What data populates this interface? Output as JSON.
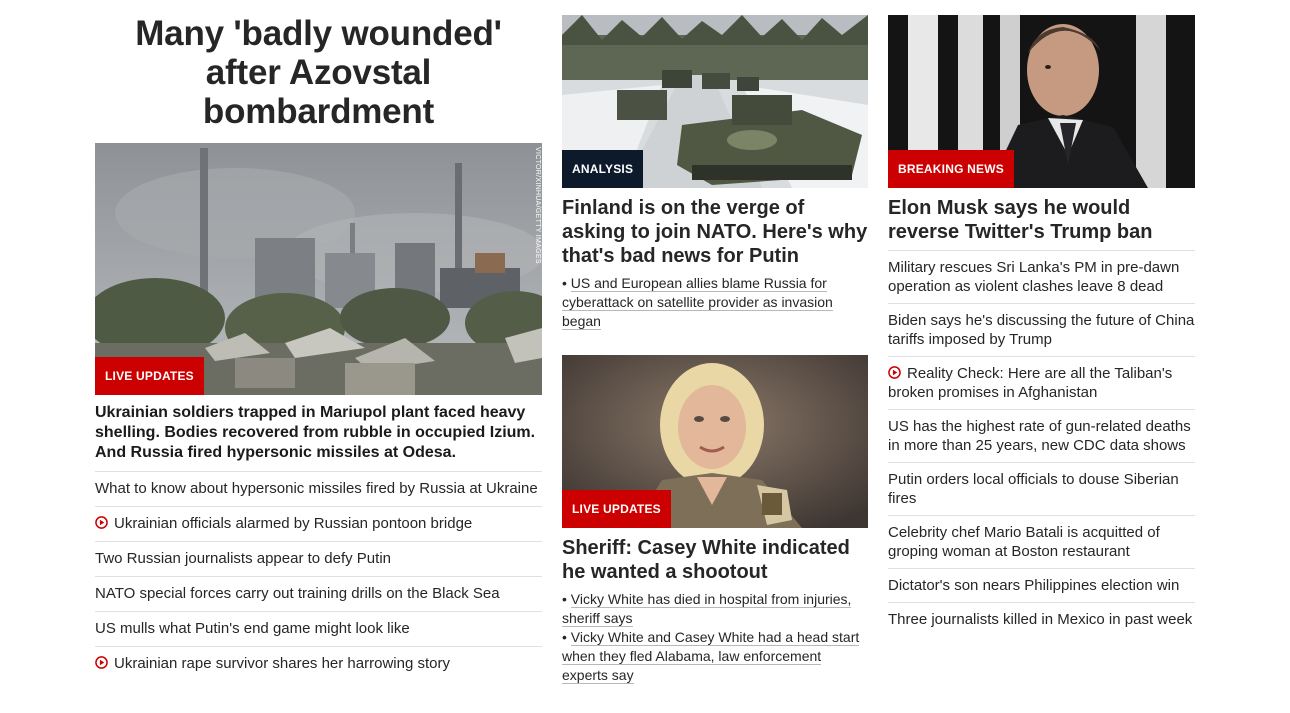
{
  "lead": {
    "headline": "Many 'badly wounded' after Azovstal bombardment",
    "badge": "LIVE UPDATES",
    "photo_credit": "VICTOR/XINHUA/GETTY IMAGES",
    "summary": "Ukrainian soldiers trapped in Mariupol plant faced heavy shelling. Bodies recovered from rubble in occupied Izium. And Russia fired hypersonic missiles at Odesa.",
    "related": [
      {
        "text": "What to know about hypersonic missiles fired by Russia at Ukraine",
        "video": false
      },
      {
        "text": "Ukrainian officials alarmed by Russian pontoon bridge",
        "video": true
      },
      {
        "text": "Two Russian journalists appear to defy Putin",
        "video": false
      },
      {
        "text": "NATO special forces carry out training drills on the Black Sea",
        "video": false
      },
      {
        "text": "US mulls what Putin's end game might look like",
        "video": false
      },
      {
        "text": "Ukrainian rape survivor shares her harrowing story",
        "video": true
      }
    ]
  },
  "finland": {
    "badge": "ANALYSIS",
    "headline": "Finland is on the verge of asking to join NATO. Here's why that's bad news for Putin",
    "bullets": [
      "US and European allies blame Russia for cyberattack on satellite provider as invasion began"
    ]
  },
  "sheriff": {
    "badge": "LIVE UPDATES",
    "headline": "Sheriff: Casey White indicated he wanted a shootout",
    "bullets": [
      "Vicky White has died in hospital from injuries, sheriff says",
      "Vicky White and Casey White had a head start when they fled Alabama, law enforcement experts say"
    ]
  },
  "musk": {
    "badge": "BREAKING NEWS",
    "headline": "Elon Musk says he would reverse Twitter's Trump ban",
    "stories": [
      {
        "text": "Military rescues Sri Lanka's PM in pre-dawn operation as violent clashes leave 8 dead",
        "video": false
      },
      {
        "text": "Biden says he's discussing the future of China tariffs imposed by Trump",
        "video": false
      },
      {
        "text": "Reality Check: Here are all the Taliban's broken promises in Afghanistan",
        "video": true
      },
      {
        "text": "US has the highest rate of gun-related deaths in more than 25 years, new CDC data shows",
        "video": false
      },
      {
        "text": "Putin orders local officials to douse Siberian fires",
        "video": false
      },
      {
        "text": "Celebrity chef Mario Batali is acquitted of groping woman at Boston restaurant",
        "video": false
      },
      {
        "text": "Dictator's son nears Philippines election win",
        "video": false
      },
      {
        "text": "Three journalists killed in Mexico in past week",
        "video": false
      }
    ]
  },
  "colors": {
    "brand_red": "#cc0000",
    "analysis_navy": "#0c1a2c",
    "text": "#262626"
  },
  "icons": {
    "video": "play-circle-icon"
  }
}
